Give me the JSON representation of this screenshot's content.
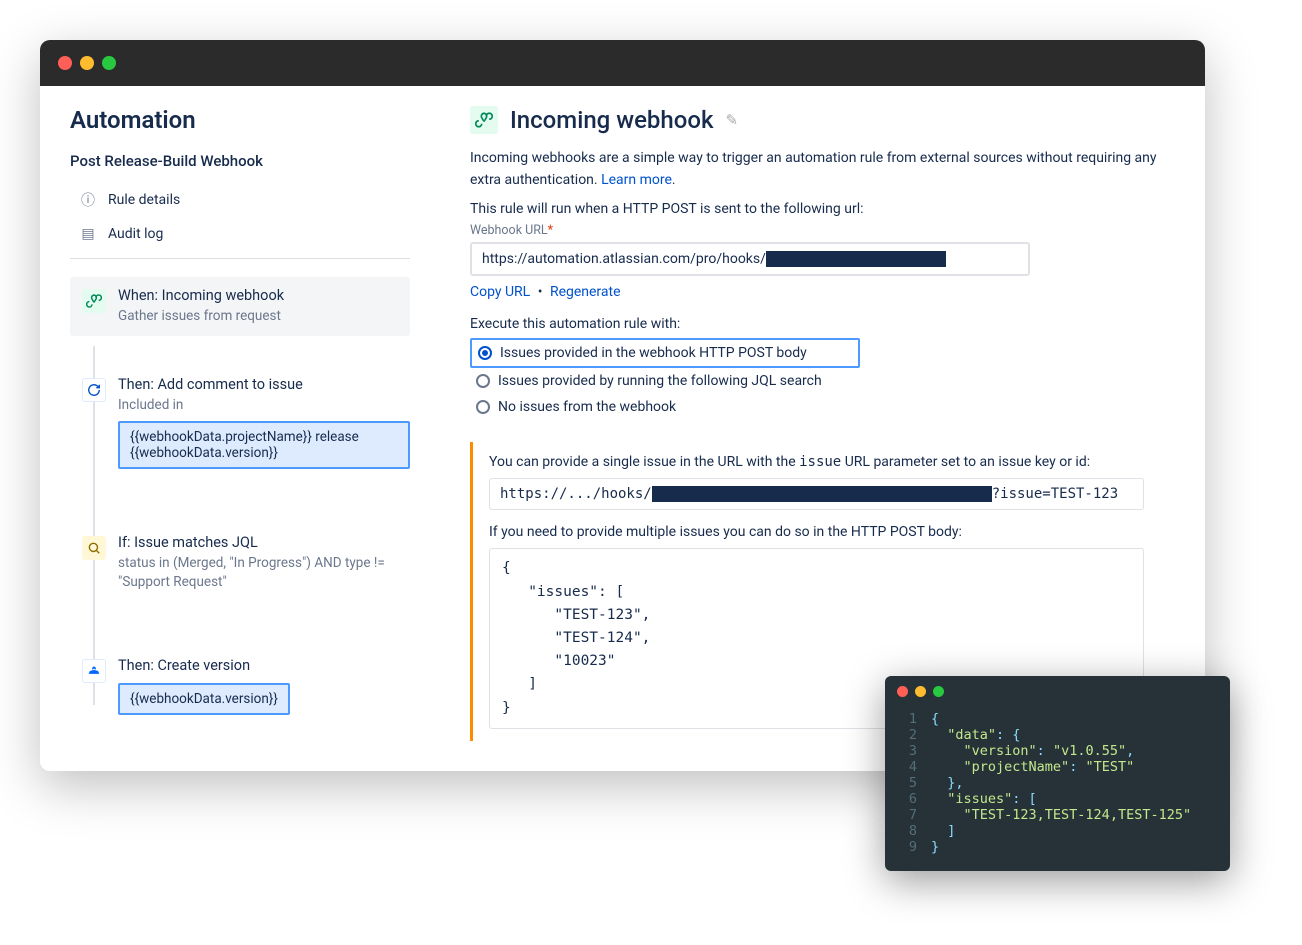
{
  "page": {
    "title": "Automation"
  },
  "rule": {
    "name": "Post Release-Build Webhook",
    "nav": {
      "details": "Rule details",
      "audit": "Audit log"
    },
    "trigger": {
      "title": "When: Incoming webhook",
      "sub": "Gather issues from request"
    },
    "steps": [
      {
        "title": "Then: Add comment to issue",
        "sub": "Included in",
        "highlight": "{{webhookData.projectName}} release {{webhookData.version}}"
      },
      {
        "title": "If: Issue matches JQL",
        "sub": "status in (Merged, \"In Progress\") AND type != \"Support Request\""
      },
      {
        "title": "Then: Create version",
        "highlight": "{{webhookData.version}}"
      }
    ]
  },
  "panel": {
    "title": "Incoming webhook",
    "desc_a": "Incoming webhooks are a simple way to trigger an automation rule from external sources without requiring any extra authentication. ",
    "learn_more": "Learn more",
    "run_when": "This rule will run when a HTTP POST is sent to the following url:",
    "url_label": "Webhook URL",
    "url_prefix": "https://automation.atlassian.com/pro/hooks/",
    "copy": "Copy URL",
    "bullet": "•",
    "regen": "Regenerate",
    "exec_label": "Execute this automation rule with:",
    "radios": [
      "Issues provided in the webhook HTTP POST body",
      "Issues provided by running the following JQL search",
      "No issues from the webhook"
    ],
    "help1_a": "You can provide a single issue in the URL with the ",
    "help1_code": "issue",
    "help1_b": " URL parameter set to an issue key or id:",
    "example_url_prefix": "https://.../hooks/",
    "example_url_suffix": "?issue=TEST-123",
    "help2": "If you need to provide multiple issues you can do so in the HTTP POST body:",
    "codeblock": "{\n   \"issues\": [\n      \"TEST-123\",\n      \"TEST-124\",\n      \"10023\"\n   ]\n}"
  },
  "floating": {
    "lines": [
      {
        "n": "1",
        "t": "{"
      },
      {
        "n": "2",
        "t": "  \"data\": {"
      },
      {
        "n": "3",
        "t": "    \"version\": \"v1.0.55\","
      },
      {
        "n": "4",
        "t": "    \"projectName\": \"TEST\""
      },
      {
        "n": "5",
        "t": "  },"
      },
      {
        "n": "6",
        "t": "  \"issues\": ["
      },
      {
        "n": "7",
        "t": "    \"TEST-123,TEST-124,TEST-125\""
      },
      {
        "n": "8",
        "t": "  ]"
      },
      {
        "n": "9",
        "t": "}"
      }
    ]
  }
}
